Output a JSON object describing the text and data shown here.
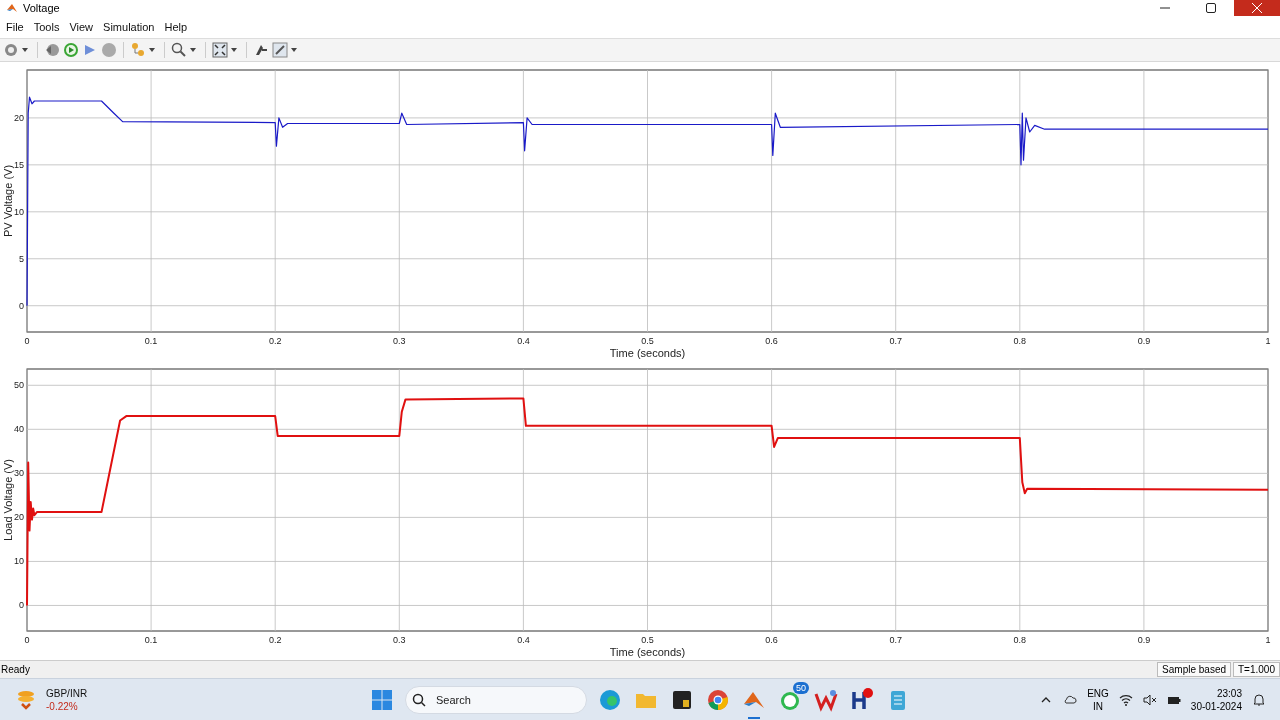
{
  "window": {
    "title": "Voltage"
  },
  "menu": [
    {
      "label": "File"
    },
    {
      "label": "Tools"
    },
    {
      "label": "View"
    },
    {
      "label": "Simulation"
    },
    {
      "label": "Help"
    }
  ],
  "plots": [
    {
      "chart_data": {
        "type": "line",
        "grid": true,
        "xlabel": "Time (seconds)",
        "ylabel": "PV Voltage (V)",
        "xlim": [
          0,
          1
        ],
        "ylim": [
          -2.8,
          25.1
        ],
        "xticks": [
          0,
          0.1,
          0.2,
          0.3,
          0.4,
          0.5,
          0.6,
          0.7,
          0.8,
          0.9,
          1
        ],
        "yticks": [
          0,
          5,
          10,
          15,
          20
        ],
        "x": [
          0,
          0.001,
          0.002,
          0.004,
          0.006,
          0.06,
          0.07,
          0.077,
          0.2,
          0.201,
          0.203,
          0.206,
          0.21,
          0.3,
          0.302,
          0.306,
          0.4,
          0.401,
          0.403,
          0.407,
          0.6,
          0.601,
          0.603,
          0.607,
          0.8,
          0.801,
          0.802,
          0.803,
          0.805,
          0.808,
          0.812,
          0.82,
          1
        ],
        "series": [
          {
            "color": "#1a1ac8",
            "values": [
              0,
              20.5,
              22.2,
              21.5,
              21.8,
              21.8,
              20.5,
              19.6,
              19.5,
              17,
              20,
              19,
              19.4,
              19.4,
              20.5,
              19.3,
              19.5,
              16.5,
              20,
              19.3,
              19.3,
              16,
              20.5,
              19,
              19.3,
              15,
              20.5,
              15.5,
              20,
              18.5,
              19.2,
              18.8,
              18.8
            ]
          }
        ]
      }
    },
    {
      "chart_data": {
        "type": "line",
        "grid": true,
        "xlabel": "Time (seconds)",
        "ylabel": "Load Voltage (V)",
        "xlim": [
          0,
          1
        ],
        "ylim": [
          -5.8,
          53.7
        ],
        "xticks": [
          0,
          0.1,
          0.2,
          0.3,
          0.4,
          0.5,
          0.6,
          0.7,
          0.8,
          0.9,
          1
        ],
        "yticks": [
          0,
          10,
          20,
          30,
          40,
          50
        ],
        "x": [
          0,
          0.001,
          0.002,
          0.003,
          0.004,
          0.005,
          0.006,
          0.008,
          0.06,
          0.075,
          0.08,
          0.2,
          0.202,
          0.3,
          0.302,
          0.305,
          0.4,
          0.402,
          0.6,
          0.602,
          0.605,
          0.8,
          0.802,
          0.804,
          0.806,
          1
        ],
        "series": [
          {
            "color": "#e01010",
            "values": [
              0,
              32.5,
              17,
              23.5,
              19.5,
              22,
              20.5,
              21.2,
              21.2,
              42,
              43,
              43,
              38.5,
              38.5,
              44,
              46.8,
              47,
              40.8,
              40.8,
              36,
              38,
              38,
              28,
              25.5,
              26.5,
              26.3
            ]
          }
        ]
      }
    }
  ],
  "status_bar": {
    "text": "Ready",
    "mode": "Sample based",
    "time": "T=1.000"
  },
  "taskbar": {
    "widget": {
      "label": "GBP/INR",
      "change": "-0.22%"
    },
    "search": {
      "placeholder": "Search"
    },
    "badge": "50",
    "tray": {
      "language": "ENG",
      "region": "IN",
      "time": "23:03",
      "date": "30-01-2024"
    }
  }
}
